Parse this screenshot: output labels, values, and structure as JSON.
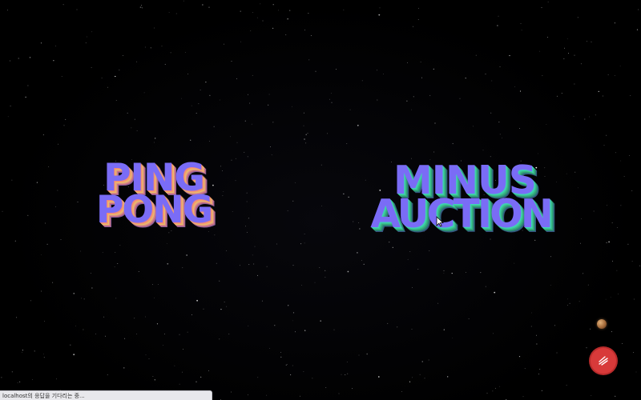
{
  "scene": {
    "background": "#000000"
  },
  "menu": {
    "games": [
      {
        "id": "ping-pong",
        "lines": [
          "PING",
          "PONG"
        ],
        "face_color": "#7a6cf6",
        "extrude_color": "#f3a06c"
      },
      {
        "id": "minus-auction",
        "lines": [
          "MINUS",
          "AUCTION"
        ],
        "face_color": "#7a6cf6",
        "extrude_color": "#3ac99e"
      }
    ]
  },
  "fab": {
    "icon": "pencil-lines-icon",
    "color": "#d83a3a"
  },
  "decor": {
    "planet_icon": "planet-icon"
  },
  "status_bar": {
    "text": "localhost의 응답을 기다리는 중..."
  }
}
